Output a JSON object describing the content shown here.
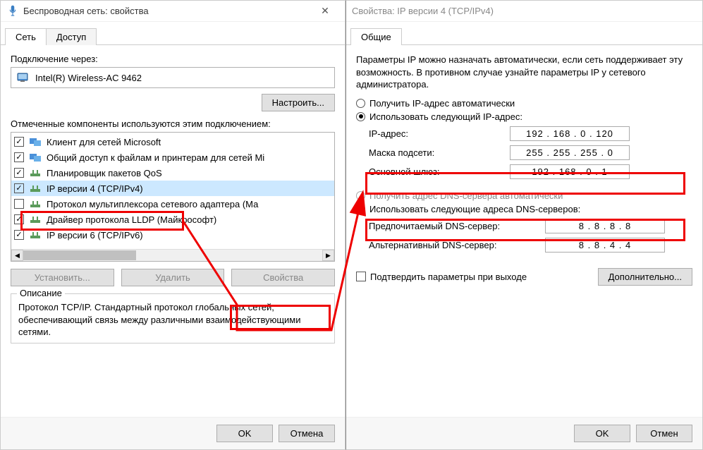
{
  "left": {
    "title": "Беспроводная сеть: свойства",
    "tabs": {
      "net": "Сеть",
      "access": "Доступ"
    },
    "connect_via": "Подключение через:",
    "adapter": "Intel(R) Wireless-AC 9462",
    "configure": "Настроить...",
    "used_components": "Отмеченные компоненты используются этим подключением:",
    "components": [
      {
        "checked": true,
        "label": "Клиент для сетей Microsoft"
      },
      {
        "checked": true,
        "label": "Общий доступ к файлам и принтерам для сетей Mi"
      },
      {
        "checked": true,
        "label": "Планировщик пакетов QoS"
      },
      {
        "checked": true,
        "label": "IP версии 4 (TCP/IPv4)",
        "selected": true
      },
      {
        "checked": false,
        "label": "Протокол мультиплексора сетевого адаптера (Ма"
      },
      {
        "checked": true,
        "label": "Драйвер протокола LLDP (Майкрософт)"
      },
      {
        "checked": true,
        "label": "IP версии 6 (TCP/IPv6)"
      }
    ],
    "btn_install": "Установить...",
    "btn_remove": "Удалить",
    "btn_props": "Свойства",
    "desc_title": "Описание",
    "desc_text": "Протокол TCP/IP. Стандартный протокол глобальных сетей, обеспечивающий связь между различными взаимодействующими сетями.",
    "ok": "OK",
    "cancel": "Отмена"
  },
  "right": {
    "title": "Свойства: IP версии 4 (TCP/IPv4)",
    "tab_general": "Общие",
    "intro": "Параметры IP можно назначать автоматически, если сеть поддерживает эту возможность. В противном случае узнайте параметры IP у сетевого администратора.",
    "radio_ip_auto": "Получить IP-адрес автоматически",
    "radio_ip_manual": "Использовать следующий IP-адрес:",
    "ip_label": "IP-адрес:",
    "ip_value": "192 . 168 .  0  . 120",
    "mask_label": "Маска подсети:",
    "mask_value": "255 . 255 . 255 .  0",
    "gw_label": "Основной шлюз:",
    "gw_value": "192 . 168 .  0  .  1",
    "radio_dns_auto": "Получить адрес DNS-сервера автоматически",
    "radio_dns_manual": "Использовать следующие адреса DNS-серверов:",
    "dns1_label": "Предпочитаемый DNS-сервер:",
    "dns1_value": "8  .  8  .  8  .  8",
    "dns2_label": "Альтернативный DNS-сервер:",
    "dns2_value": "8  .  8  .  4  .  4",
    "confirm_on_exit": "Подтвердить параметры при выходе",
    "advanced": "Дополнительно...",
    "ok": "OK",
    "cancel": "Отмен"
  }
}
